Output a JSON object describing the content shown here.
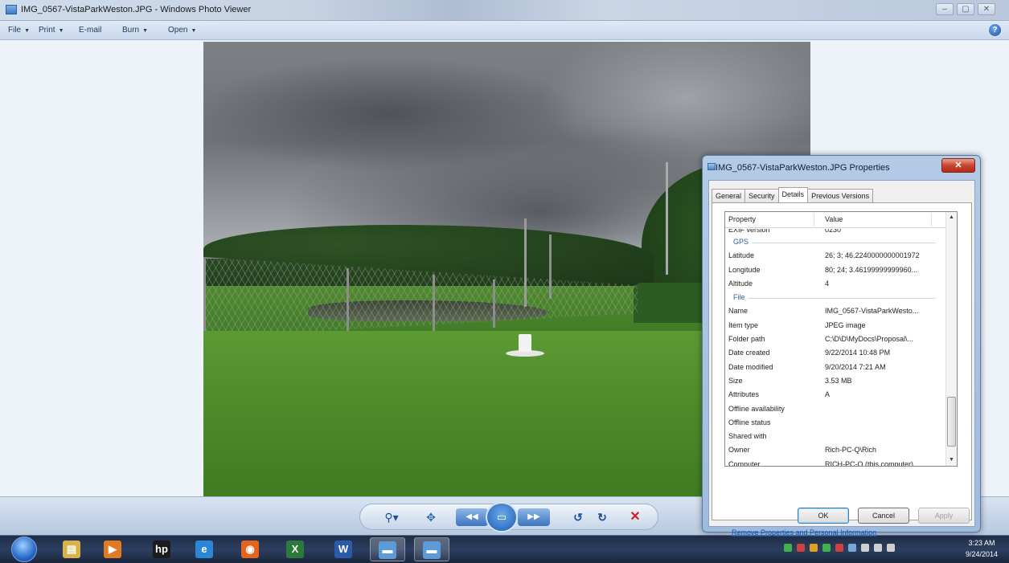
{
  "window": {
    "title": "IMG_0567-VistaParkWeston.JPG - Windows Photo Viewer",
    "controls": {
      "minimize": "–",
      "maximize": "▢",
      "close": "✕"
    }
  },
  "menubar": {
    "items": [
      {
        "label": "File",
        "has_dropdown": true
      },
      {
        "label": "Print",
        "has_dropdown": true
      },
      {
        "label": "E-mail",
        "has_dropdown": false
      },
      {
        "label": "Burn",
        "has_dropdown": true
      },
      {
        "label": "Open",
        "has_dropdown": true
      }
    ],
    "help_glyph": "?"
  },
  "viewer_controls": {
    "zoom_glyph": "⚲▾",
    "fit_glyph": "✥",
    "prev_glyph": "◀◀",
    "slideshow_glyph": "▭",
    "next_glyph": "▶▶",
    "rotate_left_glyph": "↺",
    "rotate_right_glyph": "↻",
    "delete_glyph": "✕",
    "colors": {
      "accent": "#2f6db5",
      "delete": "#d42020"
    }
  },
  "properties_dialog": {
    "title": "IMG_0567-VistaParkWeston.JPG Properties",
    "close_glyph": "✕",
    "tabs": [
      {
        "label": "General",
        "selected": false
      },
      {
        "label": "Security",
        "selected": false
      },
      {
        "label": "Details",
        "selected": true
      },
      {
        "label": "Previous Versions",
        "selected": false
      }
    ],
    "columns": {
      "property": "Property",
      "value": "Value"
    },
    "rows": [
      {
        "kind": "clipped",
        "property": "EXIF version",
        "value": "0230"
      },
      {
        "kind": "group",
        "label": "GPS"
      },
      {
        "kind": "row",
        "property": "Latitude",
        "value": "26; 3; 46.2240000000001972"
      },
      {
        "kind": "row",
        "property": "Longitude",
        "value": "80; 24; 3.46199999999960..."
      },
      {
        "kind": "row",
        "property": "Altitude",
        "value": "4"
      },
      {
        "kind": "group",
        "label": "File"
      },
      {
        "kind": "row",
        "property": "Name",
        "value": "IMG_0567-VistaParkWesto..."
      },
      {
        "kind": "row",
        "property": "Item type",
        "value": "JPEG image"
      },
      {
        "kind": "row",
        "property": "Folder path",
        "value": "C:\\D\\D\\MyDocs\\Proposal\\..."
      },
      {
        "kind": "row",
        "property": "Date created",
        "value": "9/22/2014 10:48 PM"
      },
      {
        "kind": "row",
        "property": "Date modified",
        "value": "9/20/2014 7:21 AM"
      },
      {
        "kind": "row",
        "property": "Size",
        "value": "3.53 MB"
      },
      {
        "kind": "row",
        "property": "Attributes",
        "value": "A"
      },
      {
        "kind": "row",
        "property": "Offline availability",
        "value": ""
      },
      {
        "kind": "row",
        "property": "Offline status",
        "value": ""
      },
      {
        "kind": "row",
        "property": "Shared with",
        "value": ""
      },
      {
        "kind": "row",
        "property": "Owner",
        "value": "Rich-PC-Q\\Rich"
      },
      {
        "kind": "row",
        "property": "Computer",
        "value": "RICH-PC-Q (this computer)"
      }
    ],
    "remove_link": "Remove Properties and Personal Information",
    "buttons": {
      "ok": "OK",
      "cancel": "Cancel",
      "apply": "Apply"
    }
  },
  "taskbar": {
    "pinned": [
      {
        "name": "windows-explorer",
        "glyph": "▤",
        "color": "#d9b24a",
        "active": false
      },
      {
        "name": "media-player",
        "glyph": "▶",
        "color": "#e07b22",
        "active": false
      },
      {
        "name": "hp-app",
        "glyph": "hp",
        "color": "#1b1b1b",
        "active": false
      },
      {
        "name": "internet-explorer",
        "glyph": "e",
        "color": "#2a86d6",
        "active": false
      },
      {
        "name": "firefox",
        "glyph": "◉",
        "color": "#e3641c",
        "active": false
      },
      {
        "name": "excel",
        "glyph": "X",
        "color": "#2a7a3b",
        "active": false
      },
      {
        "name": "word",
        "glyph": "W",
        "color": "#2b5aa8",
        "active": false
      },
      {
        "name": "photo-viewer",
        "glyph": "▬",
        "color": "#5c9bd8",
        "active": true
      },
      {
        "name": "photo-viewer-2",
        "glyph": "▬",
        "color": "#5c9bd8",
        "active": true
      }
    ],
    "tray_colors": [
      "#3fb24a",
      "#d04040",
      "#e0a020",
      "#3fb24a",
      "#d04040",
      "#7aa7d9",
      "#cfcfcf",
      "#cfcfcf",
      "#cfcfcf"
    ],
    "clock": {
      "time": "3:23 AM",
      "date": "9/24/2014"
    }
  }
}
